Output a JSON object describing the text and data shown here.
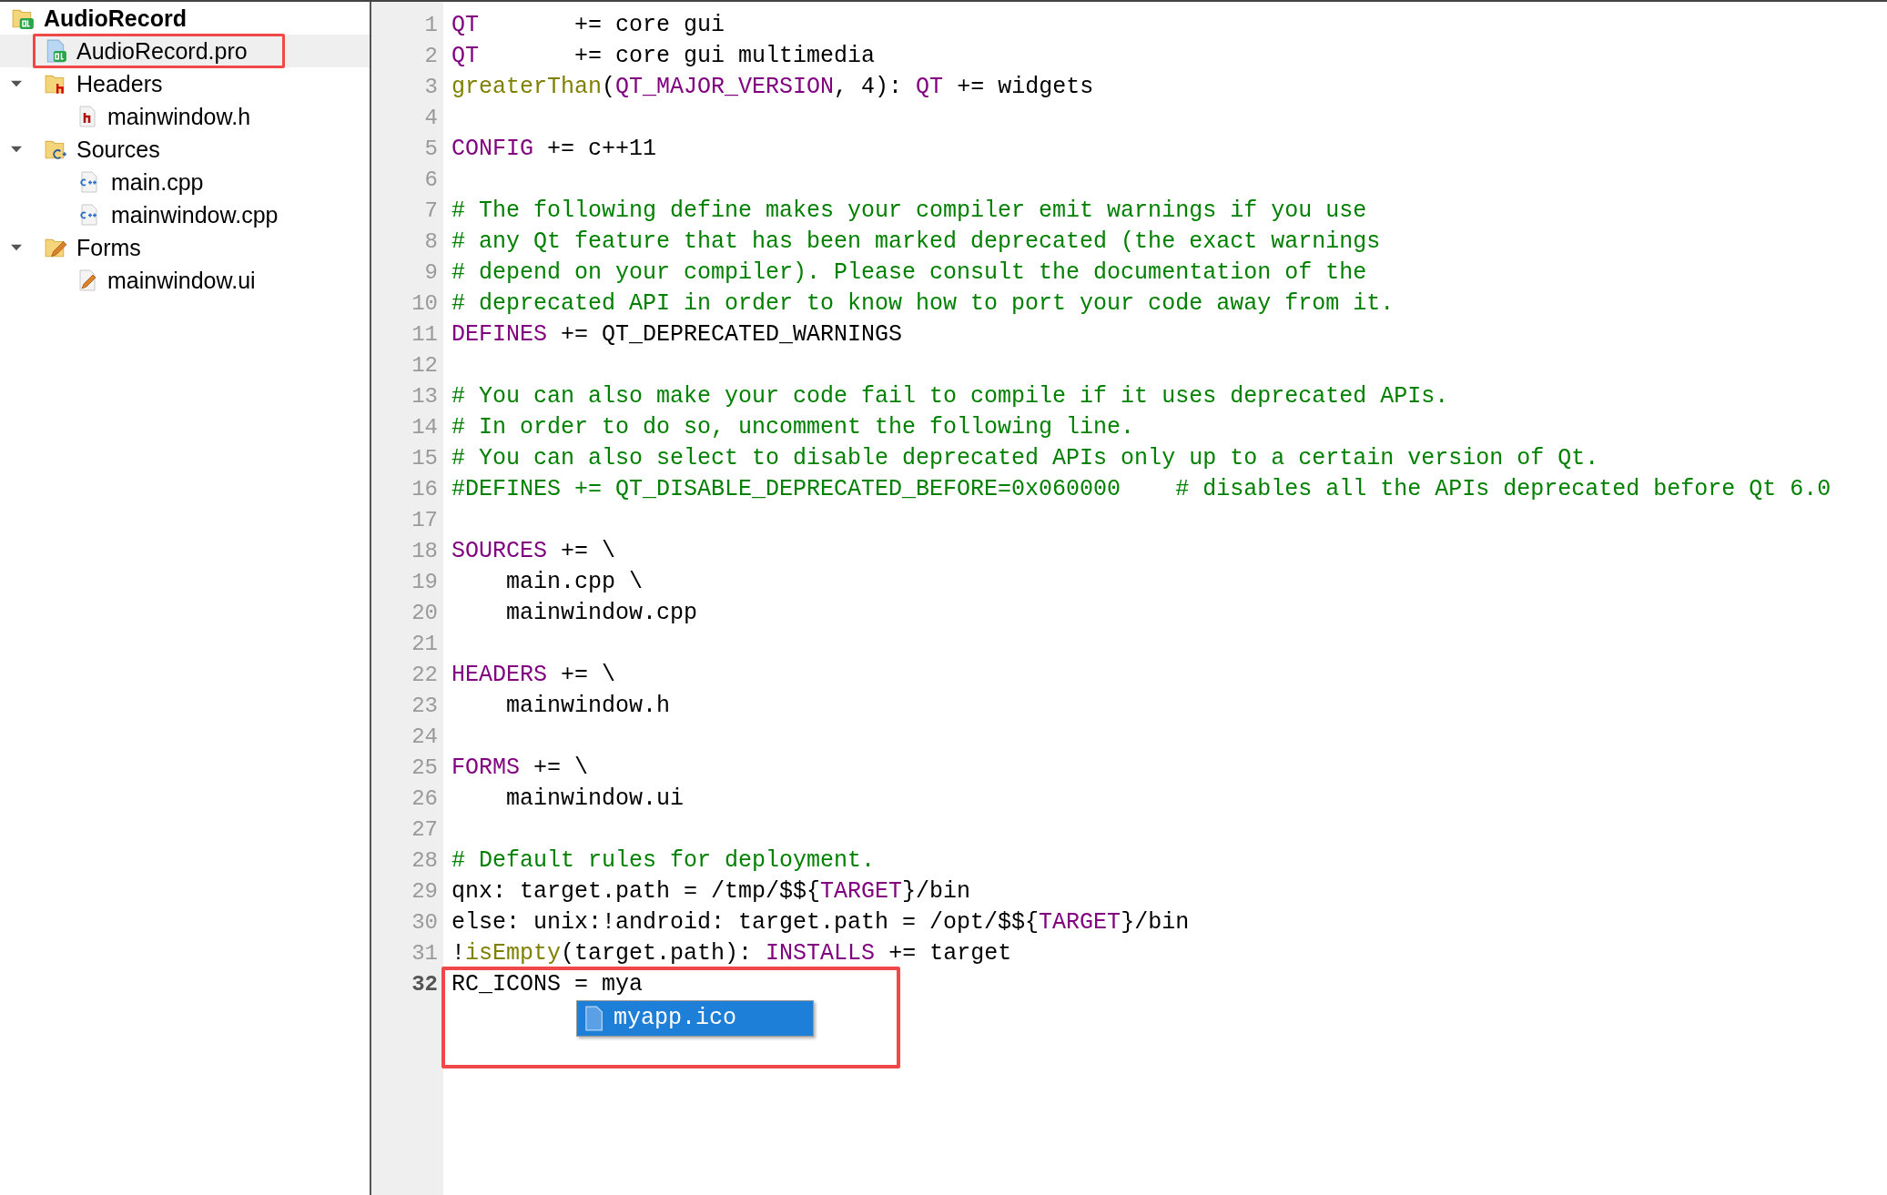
{
  "project_tree": {
    "root": {
      "label": "AudioRecord",
      "kind": "project",
      "children": [
        {
          "label": "AudioRecord.pro",
          "kind": "pro",
          "selected": true,
          "highlighted": true
        },
        {
          "label": "Headers",
          "kind": "header-folder",
          "selected": false,
          "expanded": true,
          "children": [
            {
              "label": "mainwindow.h",
              "kind": "header",
              "selected": false
            }
          ]
        },
        {
          "label": "Sources",
          "kind": "source-folder",
          "selected": false,
          "expanded": true,
          "children": [
            {
              "label": "main.cpp",
              "kind": "source",
              "selected": false
            },
            {
              "label": "mainwindow.cpp",
              "kind": "source",
              "selected": false
            }
          ]
        },
        {
          "label": "Forms",
          "kind": "form-folder",
          "selected": false,
          "expanded": true,
          "children": [
            {
              "label": "mainwindow.ui",
              "kind": "form",
              "selected": false
            }
          ]
        }
      ]
    }
  },
  "editor": {
    "lines": [
      {
        "number": "1",
        "current": false,
        "segments": [
          {
            "kind": "keyword",
            "text": "QT"
          },
          {
            "kind": "plain",
            "text": "       += core gui"
          }
        ]
      },
      {
        "number": "2",
        "current": false,
        "segments": [
          {
            "kind": "keyword",
            "text": "QT"
          },
          {
            "kind": "plain",
            "text": "       += core gui multimedia"
          }
        ]
      },
      {
        "number": "3",
        "current": false,
        "segments": [
          {
            "kind": "function",
            "text": "greaterThan"
          },
          {
            "kind": "plain",
            "text": "("
          },
          {
            "kind": "keyword",
            "text": "QT_MAJOR_VERSION"
          },
          {
            "kind": "plain",
            "text": ", 4): "
          },
          {
            "kind": "keyword",
            "text": "QT"
          },
          {
            "kind": "plain",
            "text": " += widgets"
          }
        ]
      },
      {
        "number": "4",
        "current": false
      },
      {
        "number": "5",
        "current": false,
        "segments": [
          {
            "kind": "keyword",
            "text": "CONFIG"
          },
          {
            "kind": "plain",
            "text": " += c++11"
          }
        ]
      },
      {
        "number": "6",
        "current": false
      },
      {
        "number": "7",
        "current": false,
        "segments": [
          {
            "kind": "comment",
            "text": "# The following define makes your compiler emit warnings if you use"
          }
        ]
      },
      {
        "number": "8",
        "current": false,
        "segments": [
          {
            "kind": "comment",
            "text": "# any Qt feature that has been marked deprecated (the exact warnings"
          }
        ]
      },
      {
        "number": "9",
        "current": false,
        "segments": [
          {
            "kind": "comment",
            "text": "# depend on your compiler). Please consult the documentation of the"
          }
        ]
      },
      {
        "number": "10",
        "current": false,
        "segments": [
          {
            "kind": "comment",
            "text": "# deprecated API in order to know how to port your code away from it."
          }
        ]
      },
      {
        "number": "11",
        "current": false,
        "segments": [
          {
            "kind": "keyword",
            "text": "DEFINES"
          },
          {
            "kind": "plain",
            "text": " += QT_DEPRECATED_WARNINGS"
          }
        ]
      },
      {
        "number": "12",
        "current": false
      },
      {
        "number": "13",
        "current": false,
        "segments": [
          {
            "kind": "comment",
            "text": "# You can also make your code fail to compile if it uses deprecated APIs."
          }
        ]
      },
      {
        "number": "14",
        "current": false,
        "segments": [
          {
            "kind": "comment",
            "text": "# In order to do so, uncomment the following line."
          }
        ]
      },
      {
        "number": "15",
        "current": false,
        "segments": [
          {
            "kind": "comment",
            "text": "# You can also select to disable deprecated APIs only up to a certain version of Qt."
          }
        ]
      },
      {
        "number": "16",
        "current": false,
        "segments": [
          {
            "kind": "comment",
            "text": "#DEFINES += QT_DISABLE_DEPRECATED_BEFORE=0x060000    # disables all the APIs deprecated before Qt 6.0"
          }
        ]
      },
      {
        "number": "17",
        "current": false
      },
      {
        "number": "18",
        "current": false,
        "segments": [
          {
            "kind": "keyword",
            "text": "SOURCES"
          },
          {
            "kind": "plain",
            "text": " += \\"
          }
        ]
      },
      {
        "number": "19",
        "current": false,
        "segments": [
          {
            "kind": "plain",
            "text": "    main.cpp \\"
          }
        ]
      },
      {
        "number": "20",
        "current": false,
        "segments": [
          {
            "kind": "plain",
            "text": "    mainwindow.cpp"
          }
        ]
      },
      {
        "number": "21",
        "current": false
      },
      {
        "number": "22",
        "current": false,
        "segments": [
          {
            "kind": "keyword",
            "text": "HEADERS"
          },
          {
            "kind": "plain",
            "text": " += \\"
          }
        ]
      },
      {
        "number": "23",
        "current": false,
        "segments": [
          {
            "kind": "plain",
            "text": "    mainwindow.h"
          }
        ]
      },
      {
        "number": "24",
        "current": false
      },
      {
        "number": "25",
        "current": false,
        "segments": [
          {
            "kind": "keyword",
            "text": "FORMS"
          },
          {
            "kind": "plain",
            "text": " += \\"
          }
        ]
      },
      {
        "number": "26",
        "current": false,
        "segments": [
          {
            "kind": "plain",
            "text": "    mainwindow.ui"
          }
        ]
      },
      {
        "number": "27",
        "current": false
      },
      {
        "number": "28",
        "current": false,
        "segments": [
          {
            "kind": "comment",
            "text": "# Default rules for deployment."
          }
        ]
      },
      {
        "number": "29",
        "current": false,
        "segments": [
          {
            "kind": "plain",
            "text": "qnx: target.path = /tmp/$${"
          },
          {
            "kind": "keyword",
            "text": "TARGET"
          },
          {
            "kind": "plain",
            "text": "}/bin"
          }
        ]
      },
      {
        "number": "30",
        "current": false,
        "segments": [
          {
            "kind": "plain",
            "text": "else: unix:!android: target.path = /opt/$${"
          },
          {
            "kind": "keyword",
            "text": "TARGET"
          },
          {
            "kind": "plain",
            "text": "}/bin"
          }
        ]
      },
      {
        "number": "31",
        "current": false,
        "segments": [
          {
            "kind": "plain",
            "text": "!"
          },
          {
            "kind": "function",
            "text": "isEmpty"
          },
          {
            "kind": "plain",
            "text": "(target.path): "
          },
          {
            "kind": "keyword",
            "text": "INSTALLS"
          },
          {
            "kind": "plain",
            "text": " += target"
          }
        ]
      },
      {
        "number": "32",
        "current": true,
        "segments": [
          {
            "kind": "plain",
            "text": "RC_ICONS = mya"
          }
        ]
      }
    ],
    "completion": {
      "highlighted": true,
      "items": [
        {
          "label": "myapp.ico",
          "selected": true
        }
      ]
    }
  }
}
